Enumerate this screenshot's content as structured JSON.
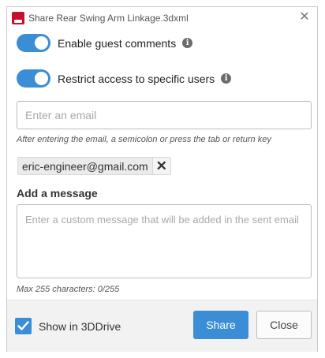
{
  "window": {
    "title": "Share Rear Swing Arm Linkage.3dxml",
    "close_glyph": "✕"
  },
  "settings": {
    "guest_comments_label": "Enable guest comments",
    "guest_comments_on": true,
    "restrict_access_label": "Restrict access to specific users",
    "restrict_access_on": true,
    "info_glyph": "i"
  },
  "email": {
    "placeholder": "Enter an email",
    "value": "",
    "hint": "After entering the email, a semicolon or press the tab or return key",
    "recipients": [
      {
        "email": "eric-engineer@gmail.com",
        "remove_glyph": "✕"
      }
    ]
  },
  "message": {
    "heading": "Add a message",
    "placeholder": "Enter a custom message that will be added in the sent email",
    "value": "",
    "counter": "Max 255 characters: 0/255"
  },
  "footer": {
    "show_in_3ddrive_label": "Show in 3DDrive",
    "show_in_3ddrive_checked": true,
    "share_label": "Share",
    "close_label": "Close"
  },
  "colors": {
    "accent": "#3b8ed6",
    "app_icon": "#c8102e",
    "footer_bg": "#f2f2f2"
  },
  "icons": {
    "app": "3dxml-app-icon",
    "close": "close-icon",
    "info": "info-icon",
    "remove": "remove-chip-icon",
    "check": "checkmark-icon"
  }
}
